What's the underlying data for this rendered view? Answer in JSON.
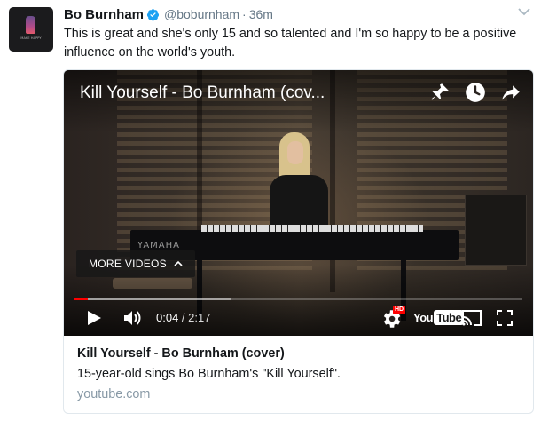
{
  "tweet": {
    "author_name": "Bo Burnham",
    "handle": "@boburnham",
    "separator": "·",
    "timestamp": "36m",
    "text": "This is great and she's only 15 and so talented and I'm so happy to be a positive influence on the world's youth.",
    "avatar_caption": "MAKE HAPPY"
  },
  "video": {
    "title": "Kill Yourself - Bo Burnham (cov...",
    "more_videos_label": "MORE VIDEOS",
    "current_time": "0:04",
    "time_separator": " / ",
    "duration": "2:17",
    "progress_fraction": 0.03,
    "buffered_fraction": 0.35,
    "hd_badge": "HD",
    "youtube_logo_text": "You",
    "youtube_logo_tube": "Tube",
    "piano_brand": "YAMAHA"
  },
  "card": {
    "title": "Kill Yourself - Bo Burnham (cover)",
    "description": "15-year-old sings Bo Burnham's \"Kill Yourself\".",
    "domain": "youtube.com"
  },
  "icons": {
    "verified": "verified-badge-icon",
    "caret": "chevron-down-icon",
    "pin": "pin-icon",
    "watch_later": "clock-icon",
    "share": "share-arrow-icon",
    "play": "play-icon",
    "volume": "volume-icon",
    "settings": "gear-icon",
    "cast": "cast-icon",
    "fullscreen": "fullscreen-icon"
  },
  "colors": {
    "verified_blue": "#1da1f2",
    "progress_red": "#ff0000",
    "link_gray": "#8899a6",
    "text": "#14171a"
  }
}
